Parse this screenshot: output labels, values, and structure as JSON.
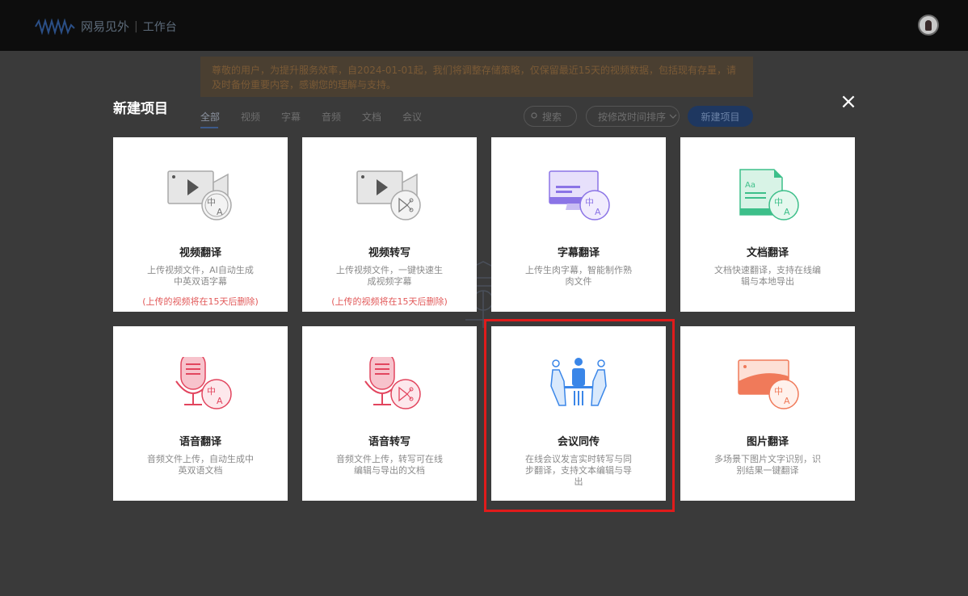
{
  "header": {
    "brand": "网易见外",
    "separator": "|",
    "workspace": "工作台"
  },
  "notice": {
    "text": "尊敬的用户，为提升服务效率，自2024-01-01起，我们将调整存储策略，仅保留最近15天的视频数据，包括现有存量，请及时备份重要内容，感谢您的理解与支持。"
  },
  "filters": {
    "tabs": [
      "全部",
      "视频",
      "字幕",
      "音频",
      "文档",
      "会议"
    ],
    "search_label": "搜索",
    "sort_label": "按修改时间排序",
    "new_project_label": "新建项目"
  },
  "modal": {
    "title": "新建项目",
    "close_icon": "×",
    "cards": [
      {
        "title": "视频翻译",
        "desc": "上传视频文件，AI自动生成中英双语字幕",
        "warn": "(上传的视频将在15天后删除)",
        "icon": "video-translate-icon"
      },
      {
        "title": "视频转写",
        "desc": "上传视频文件，一键快速生成视频字幕",
        "warn": "(上传的视频将在15天后删除)",
        "icon": "video-transcribe-icon"
      },
      {
        "title": "字幕翻译",
        "desc": "上传生肉字幕，智能制作熟肉文件",
        "warn": "",
        "icon": "subtitle-translate-icon"
      },
      {
        "title": "文档翻译",
        "desc": "文档快速翻译，支持在线编辑与本地导出",
        "warn": "",
        "icon": "document-translate-icon"
      },
      {
        "title": "语音翻译",
        "desc": "音频文件上传，自动生成中英双语文档",
        "warn": "",
        "icon": "audio-translate-icon"
      },
      {
        "title": "语音转写",
        "desc": "音频文件上传，转写可在线编辑与导出的文档",
        "warn": "",
        "icon": "audio-transcribe-icon"
      },
      {
        "title": "会议同传",
        "desc": "在线会议发言实时转写与同步翻译，支持文本编辑与导出",
        "warn": "",
        "icon": "meeting-interpret-icon"
      },
      {
        "title": "图片翻译",
        "desc": "多场景下图片文字识别，识别结果一键翻译",
        "warn": "",
        "icon": "image-translate-icon"
      }
    ]
  },
  "colors": {
    "overlay": "#3a3a3a",
    "highlight": "#e01b1b",
    "warn": "#e25a5a",
    "video_gray": "#a9a9a9",
    "subtitle_purple": "#8b74e6",
    "doc_green": "#3dbf8a",
    "audio_red": "#e2455e",
    "meeting_blue": "#3a86e8",
    "image_orange": "#f07a5a"
  }
}
